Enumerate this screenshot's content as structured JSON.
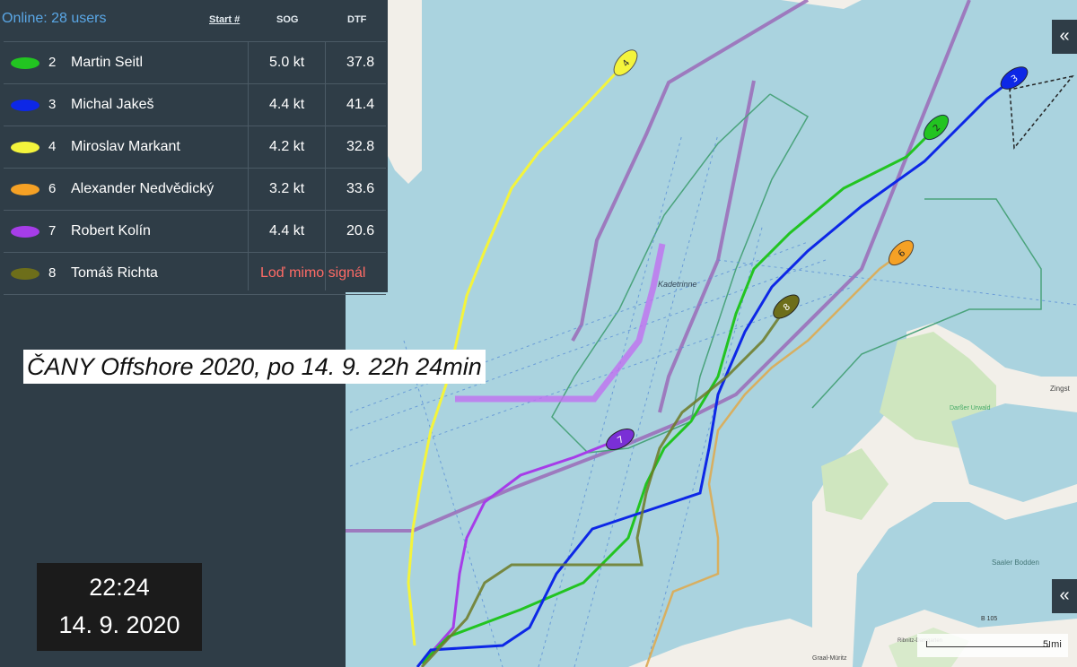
{
  "header": {
    "online": "Online: 28 users",
    "col_start": "Start #",
    "col_sog": "SOG",
    "col_dtf": "DTF"
  },
  "boats": [
    {
      "num": "2",
      "name": "Martin Seitl",
      "sog": "5.0 kt",
      "dtf": "37.8",
      "color": "#22c421"
    },
    {
      "num": "3",
      "name": "Michal Jakeš",
      "sog": "4.4 kt",
      "dtf": "41.4",
      "color": "#0d27e6"
    },
    {
      "num": "4",
      "name": "Miroslav Markant",
      "sog": "4.2 kt",
      "dtf": "32.8",
      "color": "#f4f43c"
    },
    {
      "num": "6",
      "name": "Alexander Nedvědický",
      "sog": "3.2 kt",
      "dtf": "33.6",
      "color": "#f5a125"
    },
    {
      "num": "7",
      "name": "Robert Kolín",
      "sog": "4.4 kt",
      "dtf": "20.6",
      "color": "#a63de8"
    },
    {
      "num": "8",
      "name": "Tomáš Richta",
      "status": "Loď mimo signál",
      "color": "#6d6e1a"
    }
  ],
  "caption": "ČANY Offshore 2020, po 14. 9. 22h 24min",
  "clock": {
    "time": "22:24",
    "date": "14. 9. 2020"
  },
  "map": {
    "labels": {
      "kadetrinne": "Kadetrinne",
      "zingst": "Zingst",
      "darsser": "Darßer Urwald",
      "saaler": "Saaler Bodden",
      "ribnitz": "Ribnitz-Damgarten",
      "graal": "Graal-Müritz",
      "road": "B 105"
    },
    "scale_label": "5 mi",
    "collapse_icon": "«"
  }
}
